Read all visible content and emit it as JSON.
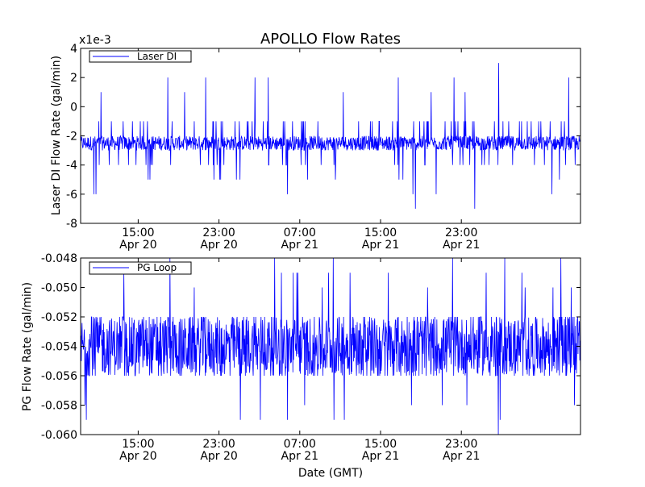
{
  "figure": {
    "title": "APOLLO Flow Rates",
    "xlabel": "Date (GMT)"
  },
  "chart_data": [
    {
      "type": "line",
      "ylabel": "Laser DI Flow Rate (gal/min)",
      "y_offset_label": "x1e-3",
      "ylim": [
        -8,
        4
      ],
      "yticks": [
        "4",
        "2",
        "0",
        "-2",
        "-4",
        "-6",
        "-8"
      ],
      "ytick_values": [
        4,
        2,
        0,
        -2,
        -4,
        -6,
        -8
      ],
      "x_range_hours": [
        0,
        49.5
      ],
      "xticks": [
        {
          "t": 5.7,
          "time": "15:00",
          "date": "Apr 20"
        },
        {
          "t": 13.7,
          "time": "23:00",
          "date": "Apr 20"
        },
        {
          "t": 21.7,
          "time": "07:00",
          "date": "Apr 21"
        },
        {
          "t": 29.7,
          "time": "15:00",
          "date": "Apr 21"
        },
        {
          "t": 37.7,
          "time": "23:00",
          "date": "Apr 21"
        }
      ],
      "legend": {
        "position": "upper-left"
      },
      "series": [
        {
          "name": "Laser DI",
          "color": "#0000ff",
          "baseline": -2.5,
          "typical_band": [
            -3,
            -2
          ],
          "frequent_excursions": [
            -4,
            -1
          ],
          "rare_spikes_up": [
            1,
            2,
            3
          ],
          "rare_spikes_down": [
            -5,
            -6,
            -7
          ]
        }
      ]
    },
    {
      "type": "line",
      "ylabel": "PG Flow Rate (gal/min)",
      "ylim": [
        -0.06,
        -0.048
      ],
      "yticks": [
        "-0.048",
        "-0.050",
        "-0.052",
        "-0.054",
        "-0.056",
        "-0.058",
        "-0.060"
      ],
      "ytick_values": [
        -0.048,
        -0.05,
        -0.052,
        -0.054,
        -0.056,
        -0.058,
        -0.06
      ],
      "x_range_hours": [
        0,
        49.5
      ],
      "xticks": [
        {
          "t": 5.7,
          "time": "15:00",
          "date": "Apr 20"
        },
        {
          "t": 13.7,
          "time": "23:00",
          "date": "Apr 20"
        },
        {
          "t": 21.7,
          "time": "07:00",
          "date": "Apr 21"
        },
        {
          "t": 29.7,
          "time": "15:00",
          "date": "Apr 21"
        },
        {
          "t": 37.7,
          "time": "23:00",
          "date": "Apr 21"
        }
      ],
      "legend": {
        "position": "upper-left"
      },
      "series": [
        {
          "name": "PG Loop",
          "color": "#0000ff",
          "baseline": -0.054,
          "typical_band": [
            -0.056,
            -0.052
          ],
          "rare_spikes_up": [
            -0.05,
            -0.049,
            -0.048
          ],
          "rare_spikes_down": [
            -0.058,
            -0.059,
            -0.06
          ]
        }
      ]
    }
  ]
}
